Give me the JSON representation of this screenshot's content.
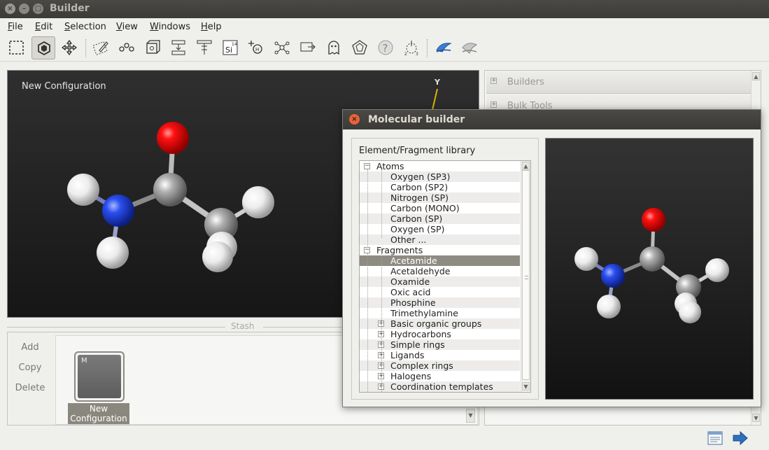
{
  "window": {
    "title": "Builder"
  },
  "menu": [
    {
      "label": "File",
      "mnemonic": "F",
      "rest": "ile"
    },
    {
      "label": "Edit",
      "mnemonic": "E",
      "rest": "dit"
    },
    {
      "label": "Selection",
      "mnemonic": "S",
      "rest": "election"
    },
    {
      "label": "View",
      "mnemonic": "V",
      "rest": "iew"
    },
    {
      "label": "Windows",
      "mnemonic": "W",
      "rest": "indows"
    },
    {
      "label": "Help",
      "mnemonic": "H",
      "rest": "elp"
    }
  ],
  "toolbar": {
    "tools": [
      "select-rectangle-icon",
      "select-atoms-icon",
      "move-icon",
      "edit-selection-icon",
      "bond-icon",
      "unit-cell-icon",
      "hierarchy-icon",
      "tree-icon",
      "element-si-icon",
      "add-atom-icon",
      "molecule-icon",
      "move-to-icon",
      "ghost-icon",
      "crystal-icon",
      "help-icon",
      "symmetry-icon",
      "surface-icon",
      "surface-alt-icon"
    ],
    "element_symbol": "Si",
    "element_number": "14"
  },
  "viewport": {
    "label": "New Configuration",
    "axis_label": "Y"
  },
  "right_panel": {
    "sections": [
      "Builders",
      "Bulk Tools"
    ]
  },
  "stash": {
    "title": "Stash",
    "buttons": {
      "add": "Add",
      "copy": "Copy",
      "delete": "Delete"
    },
    "item": {
      "badge": "M",
      "label_line1": "New",
      "label_line2": "Configuration"
    }
  },
  "dialog": {
    "title": "Molecular builder",
    "library_label": "Element/Fragment library",
    "tree": {
      "atoms_header": "Atoms",
      "atoms": [
        "Oxygen (SP3)",
        "Carbon (SP2)",
        "Nitrogen (SP)",
        "Carbon (MONO)",
        "Carbon (SP)",
        "Oxygen (SP)",
        "Other ..."
      ],
      "fragments_header": "Fragments",
      "fragments": [
        "Acetamide",
        "Acetaldehyde",
        "Oxamide",
        "Oxic acid",
        "Phosphine",
        "Trimethylamine"
      ],
      "selected": "Acetamide",
      "groups": [
        "Basic organic groups",
        "Hydrocarbons",
        "Simple rings",
        "Ligands",
        "Complex rings",
        "Halogens",
        "Coordination templates"
      ]
    }
  },
  "colors": {
    "oxygen": "#e00000",
    "nitrogen": "#2040e0",
    "carbon": "#a8a8a8",
    "hydrogen": "#f4f4f4",
    "selection": "#8e8b82",
    "dialog_close": "#e8633a"
  }
}
